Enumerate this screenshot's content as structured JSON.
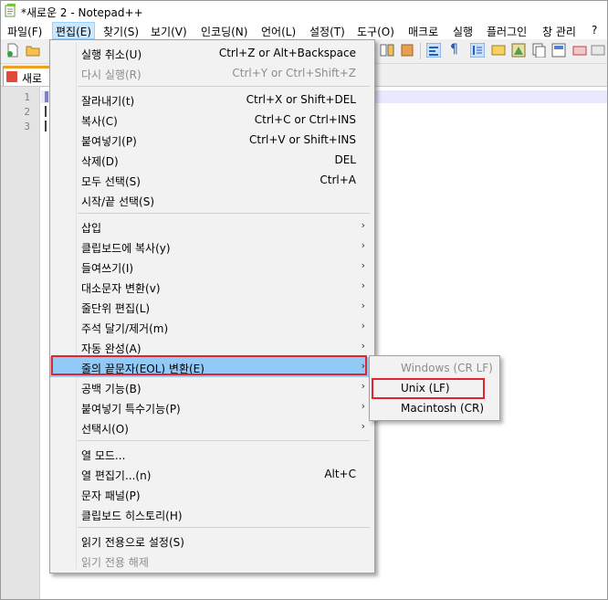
{
  "window": {
    "title": "*새로운 2 - Notepad++"
  },
  "menubar": {
    "items": [
      "파일(F)",
      "편집(E)",
      "찾기(S)",
      "보기(V)",
      "인코딩(N)",
      "언어(L)",
      "설정(T)",
      "도구(O)",
      "매크로",
      "실행",
      "플러그인",
      "창 관리",
      "?"
    ],
    "active_index": 1
  },
  "tab": {
    "label": "새로운"
  },
  "editor": {
    "line_numbers": [
      "1",
      "2",
      "3"
    ]
  },
  "edit_menu": {
    "groups": [
      [
        {
          "label": "실행 취소(U)",
          "shortcut": "Ctrl+Z or Alt+Backspace",
          "disabled": false
        },
        {
          "label": "다시 실행(R)",
          "shortcut": "Ctrl+Y or Ctrl+Shift+Z",
          "disabled": true
        }
      ],
      [
        {
          "label": "잘라내기(t)",
          "shortcut": "Ctrl+X or Shift+DEL"
        },
        {
          "label": "복사(C)",
          "shortcut": "Ctrl+C or Ctrl+INS"
        },
        {
          "label": "붙여넣기(P)",
          "shortcut": "Ctrl+V or Shift+INS"
        },
        {
          "label": "삭제(D)",
          "shortcut": "DEL"
        },
        {
          "label": "모두 선택(S)",
          "shortcut": "Ctrl+A"
        },
        {
          "label": "시작/끝 선택(S)",
          "shortcut": ""
        }
      ],
      [
        {
          "label": "삽입",
          "submenu": true
        },
        {
          "label": "클립보드에 복사(y)",
          "submenu": true
        },
        {
          "label": "들여쓰기(I)",
          "submenu": true
        },
        {
          "label": "대소문자 변환(v)",
          "submenu": true
        },
        {
          "label": "줄단위 편집(L)",
          "submenu": true
        },
        {
          "label": "주석 달기/제거(m)",
          "submenu": true
        },
        {
          "label": "자동 완성(A)",
          "submenu": true
        },
        {
          "label": "줄의 끝문자(EOL) 변환(E)",
          "submenu": true,
          "highlighted": true
        },
        {
          "label": "공백 기능(B)",
          "submenu": true
        },
        {
          "label": "붙여넣기 특수기능(P)",
          "submenu": true
        },
        {
          "label": "선택시(O)",
          "submenu": true
        }
      ],
      [
        {
          "label": "열 모드...",
          "shortcut": ""
        },
        {
          "label": "열 편집기...(n)",
          "shortcut": "Alt+C"
        },
        {
          "label": "문자 패널(P)",
          "shortcut": ""
        },
        {
          "label": "클립보드 히스토리(H)",
          "shortcut": ""
        }
      ],
      [
        {
          "label": "읽기 전용으로 설정(S)",
          "shortcut": ""
        },
        {
          "label": "읽기 전용 해제",
          "shortcut": "",
          "disabled": true
        }
      ]
    ]
  },
  "eol_submenu": {
    "items": [
      {
        "label": "Windows (CR LF)",
        "disabled": true
      },
      {
        "label": "Unix (LF)",
        "disabled": false,
        "boxed": true
      },
      {
        "label": "Macintosh (CR)",
        "disabled": false
      }
    ]
  },
  "colors": {
    "highlight": "#91c9f7",
    "annotation_red": "#e0262c",
    "menu_bg": "#f2f2f2"
  }
}
